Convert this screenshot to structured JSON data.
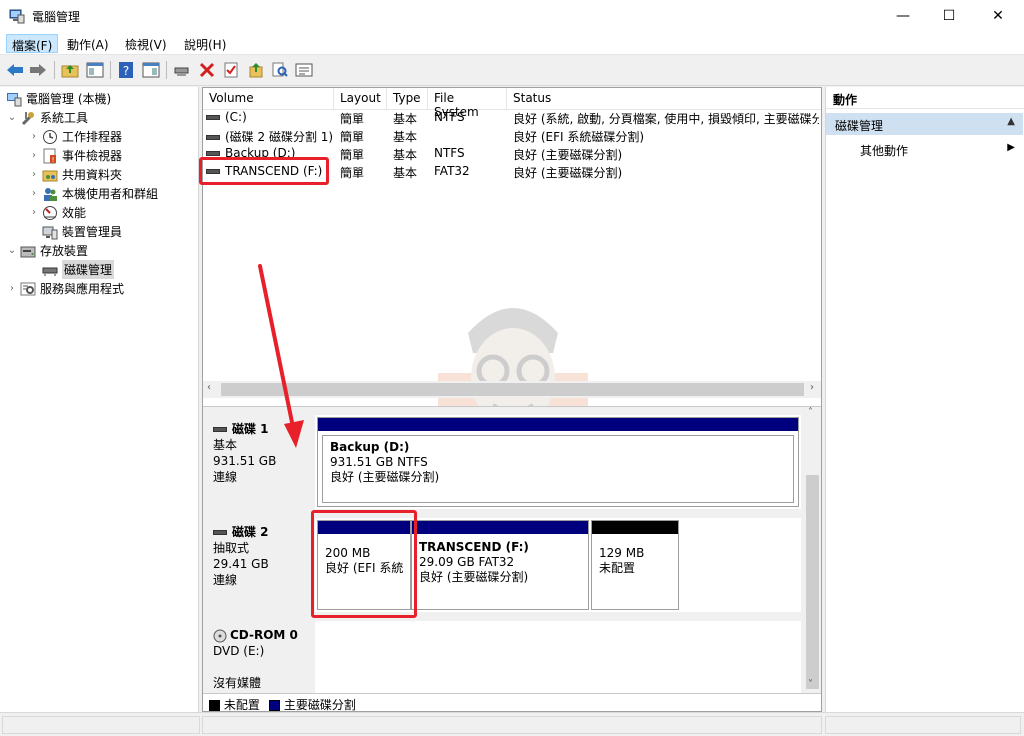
{
  "window": {
    "title": "電腦管理",
    "minimize": "—",
    "maximize": "☐",
    "close": "✕"
  },
  "menu": [
    {
      "label": "檔案(F)",
      "active": true
    },
    {
      "label": "動作(A)"
    },
    {
      "label": "檢視(V)"
    },
    {
      "label": "說明(H)"
    }
  ],
  "toolbar": [
    "back-icon",
    "forward-icon",
    "up-folder-icon",
    "show-hide-tree-icon",
    "help-icon",
    "action-pane-icon",
    "connect-drive-icon",
    "delete-icon",
    "check-icon",
    "export-icon",
    "search-icon",
    "properties-icon"
  ],
  "tree": {
    "root": "電腦管理 (本機)",
    "system_tools": "系統工具",
    "task_scheduler": "工作排程器",
    "event_viewer": "事件檢視器",
    "shared_folders": "共用資料夾",
    "local_users": "本機使用者和群組",
    "performance": "效能",
    "device_manager": "裝置管理員",
    "storage": "存放裝置",
    "disk_mgmt": "磁碟管理",
    "services": "服務與應用程式"
  },
  "volume_table": {
    "headers": [
      "Volume",
      "Layout",
      "Type",
      "File System",
      "Status"
    ],
    "rows": [
      {
        "volume": "(C:)",
        "layout": "簡單",
        "type": "基本",
        "fs": "NTFS",
        "status": "良好 (系統, 啟動, 分頁檔案, 使用中, 損毀傾印, 主要磁碟分"
      },
      {
        "volume": "(磁碟 2 磁碟分割 1)",
        "layout": "簡單",
        "type": "基本",
        "fs": "",
        "status": "良好 (EFI 系統磁碟分割)"
      },
      {
        "volume": "Backup (D:)",
        "layout": "簡單",
        "type": "基本",
        "fs": "NTFS",
        "status": "良好 (主要磁碟分割)"
      },
      {
        "volume": "TRANSCEND (F:)",
        "layout": "簡單",
        "type": "基本",
        "fs": "FAT32",
        "status": "良好 (主要磁碟分割)"
      }
    ]
  },
  "disks": [
    {
      "name": "磁碟 1",
      "kind": "基本",
      "size": "931.51 GB",
      "state": "連線",
      "partitions": [
        {
          "name": "Backup  (D:)",
          "detail": "931.51 GB NTFS",
          "status": "良好 (主要磁碟分割)",
          "color": "#00007f"
        }
      ]
    },
    {
      "name": "磁碟 2",
      "kind": "抽取式",
      "size": "29.41 GB",
      "state": "連線",
      "partitions": [
        {
          "name": "",
          "detail": "200 MB",
          "status": "良好 (EFI 系統",
          "color": "#00007f"
        },
        {
          "name": "TRANSCEND  (F:)",
          "detail": "29.09 GB FAT32",
          "status": "良好 (主要磁碟分割)",
          "color": "#00007f"
        },
        {
          "name": "",
          "detail": "129 MB",
          "status": "未配置",
          "color": "#000000"
        }
      ]
    },
    {
      "name": "CD-ROM 0",
      "kind": "DVD (E:)",
      "size": "",
      "state": "沒有媒體"
    }
  ],
  "legend": {
    "unallocated": "未配置",
    "primary": "主要磁碟分割",
    "unallocated_color": "#000000",
    "primary_color": "#00007f"
  },
  "actions": {
    "header": "動作",
    "section": "磁碟管理",
    "more": "其他動作"
  },
  "colors": {
    "annotation_red": "#e8202a",
    "selection_blue": "#cce8ff"
  }
}
